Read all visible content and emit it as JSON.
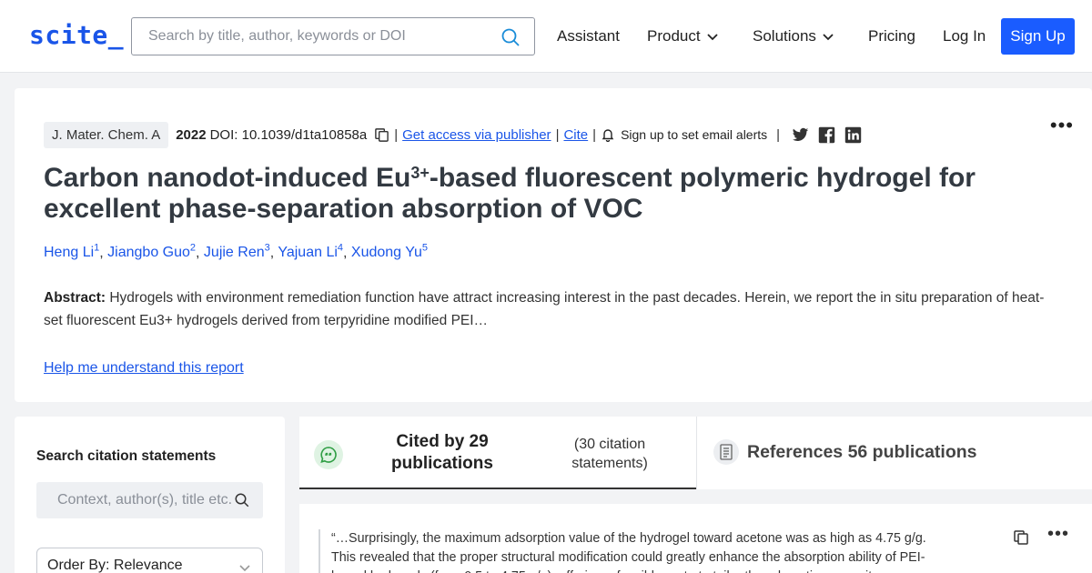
{
  "header": {
    "logo": "scite_",
    "search_placeholder": "Search by title, author, keywords or DOI",
    "nav": {
      "assistant": "Assistant",
      "product": "Product",
      "solutions": "Solutions",
      "pricing": "Pricing",
      "login": "Log In",
      "signup": "Sign Up"
    }
  },
  "paper": {
    "journal": "J. Mater. Chem. A",
    "year": "2022",
    "doi": "DOI: 10.1039/d1ta10858a",
    "access_link": "Get access via publisher",
    "cite_link": "Cite",
    "alert_text": "Sign up to set email alerts",
    "more": "•••",
    "title_part1": "Carbon nanodot-induced Eu",
    "title_sup": "3+",
    "title_part2": "-based fluorescent polymeric hydrogel for excellent phase-separation absorption of VOC",
    "authors": [
      {
        "name": "Heng Li",
        "num": "1"
      },
      {
        "name": "Jiangbo Guo",
        "num": "2"
      },
      {
        "name": "Jujie Ren",
        "num": "3"
      },
      {
        "name": "Yajuan Li",
        "num": "4"
      },
      {
        "name": "Xudong Yu",
        "num": "5"
      }
    ],
    "abstract_label": "Abstract:",
    "abstract_text": " Hydrogels with environment remediation function have attract increasing interest in the past decades. Herein, we report the in situ preparation of heat-set fluorescent Eu3+ hydrogels derived from terpyridine modified PEI…",
    "help_link": "Help me understand this report"
  },
  "sidebar": {
    "title": "Search citation statements",
    "search_placeholder": "Context, author(s), title etc.",
    "order_by": "Order By: Relevance"
  },
  "tabs": {
    "cited_by": "Cited by 29 publications",
    "citation_statements": "(30 citation statements)",
    "references": "References 56 publications"
  },
  "statement": {
    "quote": "“…Surprisingly, the maximum adsorption value of the hydrogel toward acetone was as high as 4.75 g/g. This revealed that the proper structural modification could greatly enhance the absorption ability of PEI-based hydrogels (from 0.5 to 4.75 g/g), offering a feasible route to tailor the adsorption capacity…",
    "more": "•••"
  },
  "colors": {
    "brand": "#1a55e8",
    "signup_bg": "#1a5cff",
    "page_bg": "#f2f3f5"
  },
  "icons": [
    "search-icon",
    "chevron-down-icon",
    "copy-icon",
    "bell-icon",
    "twitter-icon",
    "facebook-icon",
    "linkedin-icon",
    "quote-bubble-icon",
    "document-icon",
    "more-icon"
  ]
}
